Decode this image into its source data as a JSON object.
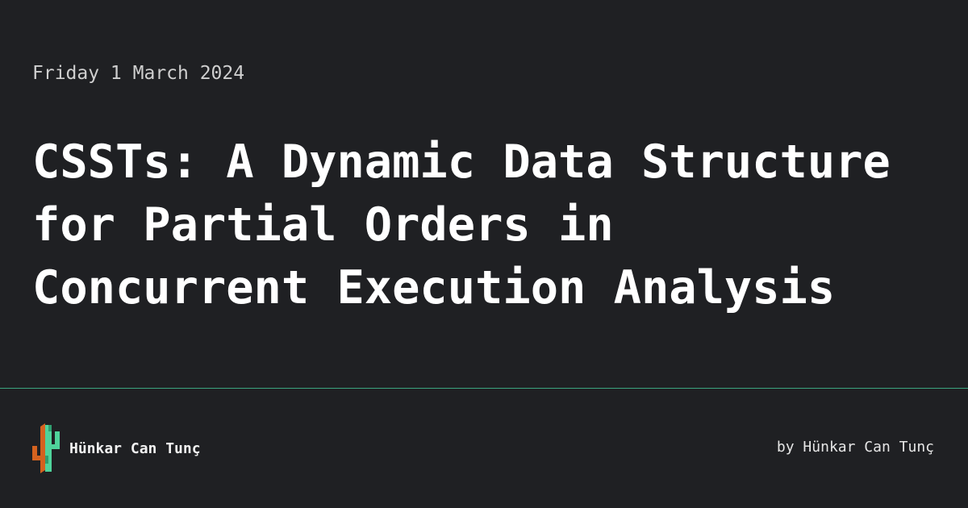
{
  "header": {
    "date": "Friday 1 March 2024"
  },
  "post": {
    "title_lines": [
      "CSSTs: A Dynamic Data Structure",
      "for Partial Orders in",
      "Concurrent Execution Analysis"
    ]
  },
  "footer": {
    "logo_icon": "cactus-logo-icon",
    "site_name": "Hünkar Can Tunç",
    "byline": "by Hünkar Can Tunç"
  },
  "colors": {
    "background": "#1f2023",
    "divider": "#3aa57f",
    "logo_green": "#4fd39b",
    "logo_orange": "#d4621f"
  }
}
